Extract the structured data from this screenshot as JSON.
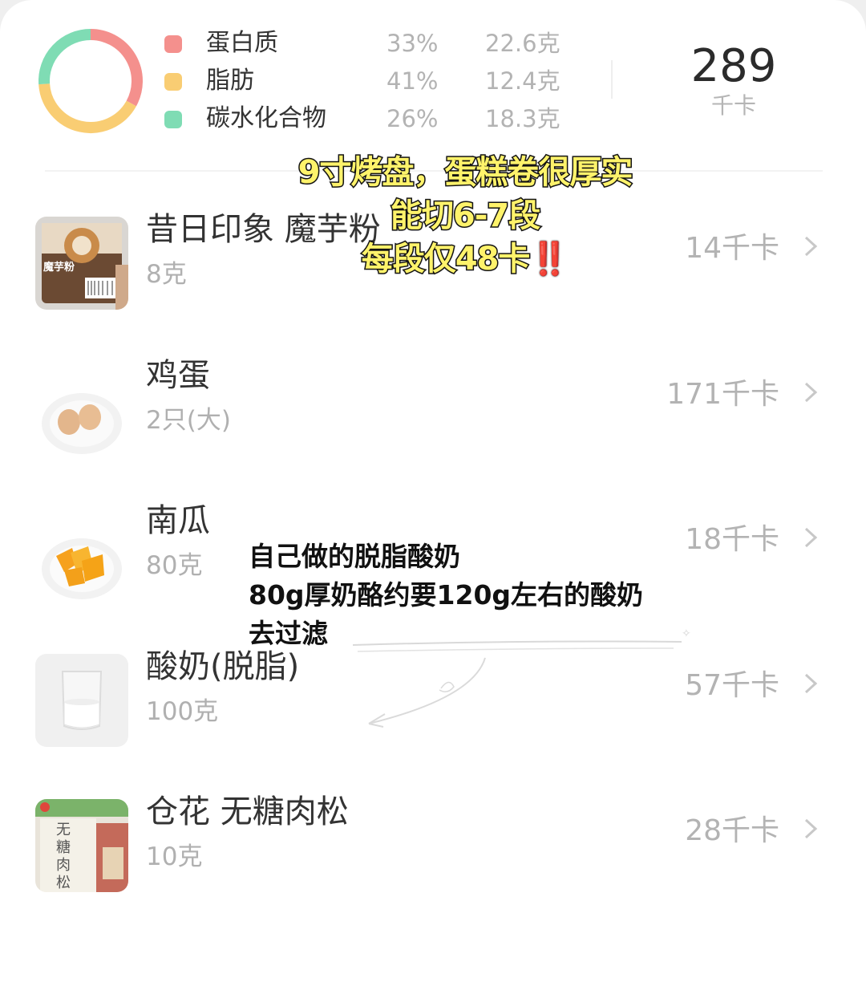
{
  "summary": {
    "macros": [
      {
        "name": "蛋白质",
        "percent": "33%",
        "grams": "22.6克",
        "color": "#f4908d",
        "share": 0.33
      },
      {
        "name": "脂肪",
        "percent": "41%",
        "grams": "12.4克",
        "color": "#f9cd73",
        "share": 0.41
      },
      {
        "name": "碳水化合物",
        "percent": "26%",
        "grams": "18.3克",
        "color": "#7fdcb4",
        "share": 0.26
      }
    ],
    "total_kcal": "289",
    "total_unit": "千卡"
  },
  "foods": [
    {
      "name": "昔日印象 魔芋粉",
      "amount": "8克",
      "kcal": "14千卡",
      "thumb_icon": "konjac-flour-package-icon",
      "thumb_label": "魔芋粉"
    },
    {
      "name": "鸡蛋",
      "amount": "2只(大)",
      "kcal": "171千卡",
      "thumb_icon": "eggs-plate-icon"
    },
    {
      "name": "南瓜",
      "amount": "80克",
      "kcal": "18千卡",
      "thumb_icon": "pumpkin-plate-icon"
    },
    {
      "name": "酸奶(脱脂)",
      "amount": "100克",
      "kcal": "57千卡",
      "thumb_icon": "yogurt-glass-icon"
    },
    {
      "name": "仓花 无糖肉松",
      "amount": "10克",
      "kcal": "28千卡",
      "thumb_icon": "meat-floss-package-icon",
      "thumb_label": "无糖肉松"
    }
  ],
  "overlay": {
    "top_lines": [
      "9寸烤盘，蛋糕卷很厚实",
      "能切6-7段",
      "每段仅48卡"
    ],
    "top_emoji": "‼️",
    "mid_lines": [
      "自己做的脱脂酸奶",
      "80g厚奶酪约要120g左右的酸奶",
      "去过滤"
    ]
  }
}
